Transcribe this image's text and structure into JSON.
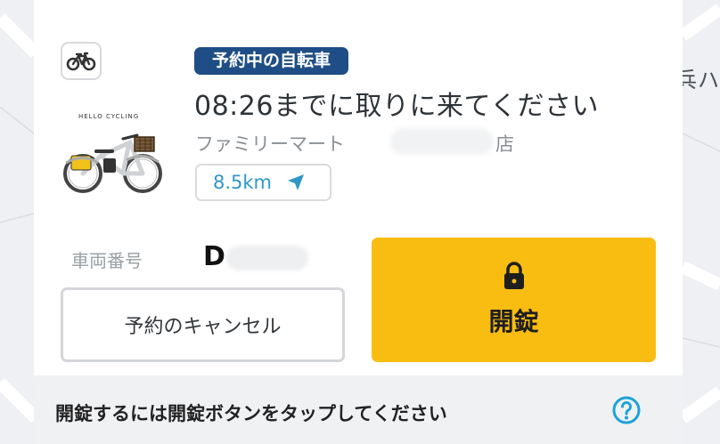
{
  "map": {
    "corner_label": "兵ハ"
  },
  "reservation": {
    "vehicle_type_icon": "bicycle-icon",
    "brand_logo_text": "HELLO CYCLING",
    "status_badge": "予約中の自転車",
    "pickup_deadline": "08:26までに取りに来てください",
    "station_prefix": "ファミリーマート",
    "station_suffix": "店",
    "distance": "8.5km",
    "distance_icon": "navigation-arrow-icon"
  },
  "vehicle": {
    "label": "車両番号",
    "number_prefix": "D"
  },
  "actions": {
    "cancel_label": "予約のキャンセル",
    "unlock_label": "開錠",
    "unlock_icon": "lock-icon"
  },
  "hint": {
    "text": "開錠するには開錠ボタンをタップしてください",
    "help_icon": "question-circle-icon"
  },
  "colors": {
    "badge_bg": "#1f4e86",
    "unlock_bg": "#f9bd12",
    "distance_text": "#2e98c7",
    "help_icon": "#1ea2d8"
  }
}
